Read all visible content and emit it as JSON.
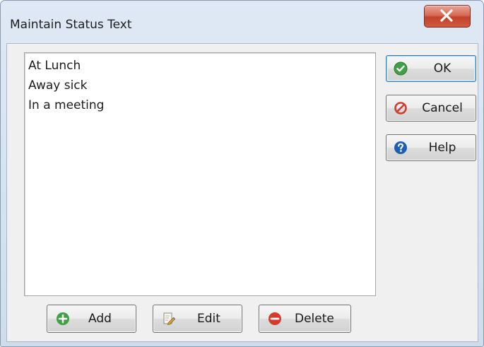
{
  "window": {
    "title": "Maintain Status Text",
    "close_glyph": "✕"
  },
  "status_list": {
    "items": [
      "At Lunch",
      "Away sick",
      "In a meeting"
    ]
  },
  "side_buttons": {
    "ok_label": "OK",
    "cancel_label": "Cancel",
    "help_label": "Help"
  },
  "bottom_buttons": {
    "add_label": "Add",
    "edit_label": "Edit",
    "delete_label": "Delete"
  },
  "icons": {
    "ok": "check-circle-icon",
    "cancel": "no-entry-icon",
    "help": "question-circle-icon",
    "add": "plus-circle-icon",
    "edit": "pencil-document-icon",
    "delete": "minus-circle-icon",
    "close": "close-icon"
  },
  "colors": {
    "ok_green": "#3fa045",
    "cancel_red": "#d23b2e",
    "help_blue": "#1c5fb2",
    "add_green": "#3fa045",
    "delete_red": "#d53a2c",
    "close_red": "#c8432c"
  }
}
